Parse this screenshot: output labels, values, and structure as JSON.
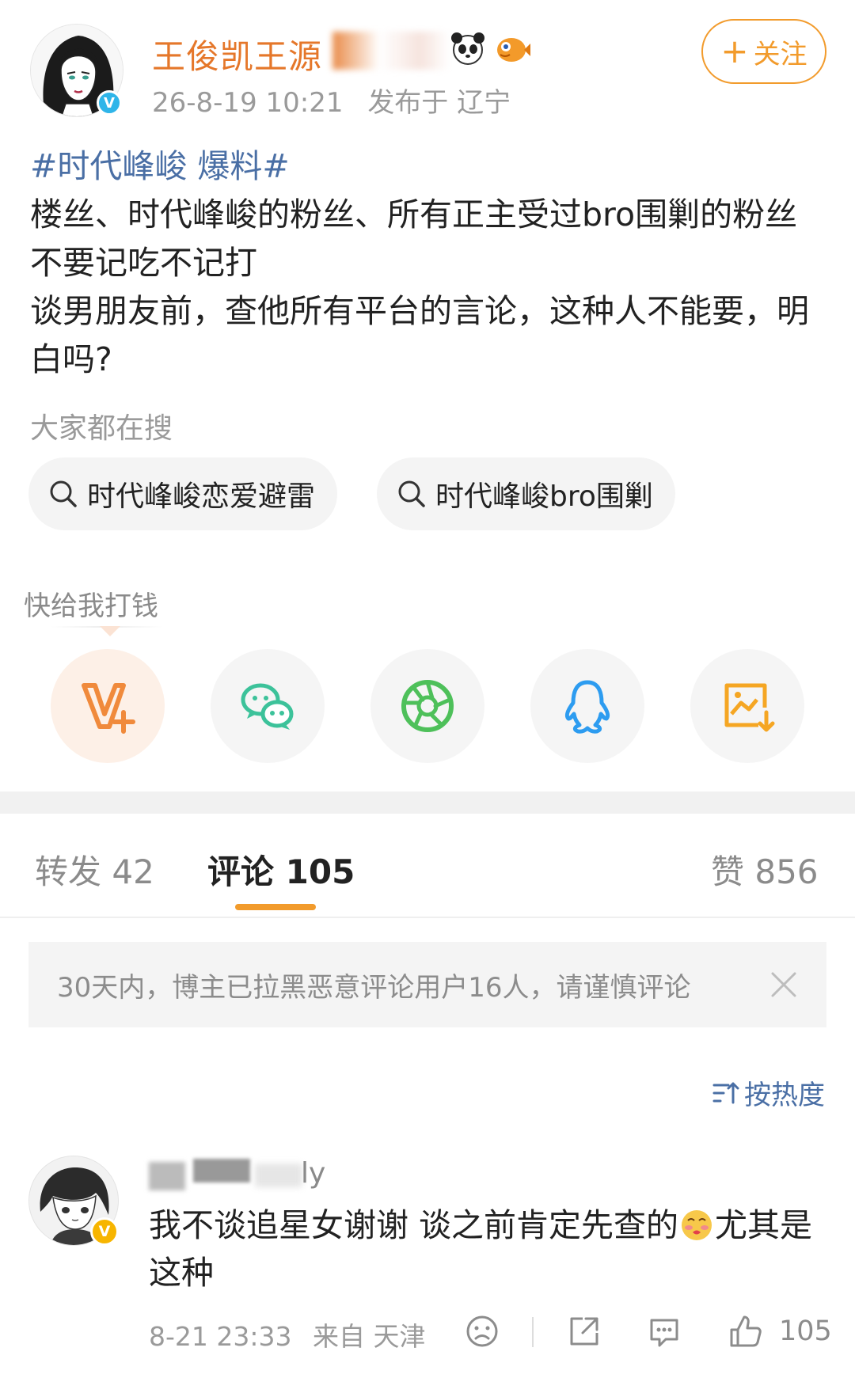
{
  "post": {
    "author": {
      "name": "王俊凯王源",
      "verified_badge": "V"
    },
    "time": "26-8-19 10:21",
    "location": "发布于 辽宁",
    "follow_label": "关注",
    "topic": "#时代峰峻 爆料#",
    "paragraphs": [
      "楼丝、时代峰峻的粉丝、所有正主受过bro围剿的粉丝不要记吃不记打",
      "谈男朋友前，查他所有平台的言论，这种人不能要，明白吗?"
    ]
  },
  "search": {
    "label": "大家都在搜",
    "pills": [
      {
        "text": "时代峰峻恋爱避雷"
      },
      {
        "text": "时代峰峻bro围剿"
      }
    ]
  },
  "share": {
    "label": "快给我打钱",
    "buttons": [
      {
        "icon": "v-plus-icon",
        "color": "#f08a3c"
      },
      {
        "icon": "wechat-icon",
        "color": "#3cc29a"
      },
      {
        "icon": "moments-icon",
        "color": "#4ec05a"
      },
      {
        "icon": "qq-icon",
        "color": "#2d9cf0"
      },
      {
        "icon": "save-image-icon",
        "color": "#f5a623"
      }
    ]
  },
  "tabs": [
    {
      "label": "转发 42"
    },
    {
      "label": "评论 105"
    },
    {
      "label": "赞 856"
    }
  ],
  "notice": {
    "text": "30天内，博主已拉黑恶意评论用户16人，请谨慎评论"
  },
  "sort": {
    "label": "按热度"
  },
  "comment": {
    "username_suffix": "ly",
    "text_before_emoji": "我不谈追星女谢谢 谈之前肯定先查的",
    "text_after_emoji": "尤其是这种",
    "time": "8-21 23:33",
    "location": "来自 天津",
    "like_count": "105",
    "badge": "V"
  },
  "colors": {
    "brand_orange": "#f29b2c",
    "author_orange": "#e5772a",
    "topic_blue": "#4a6fa5",
    "muted_gray": "#9a9a9a"
  }
}
